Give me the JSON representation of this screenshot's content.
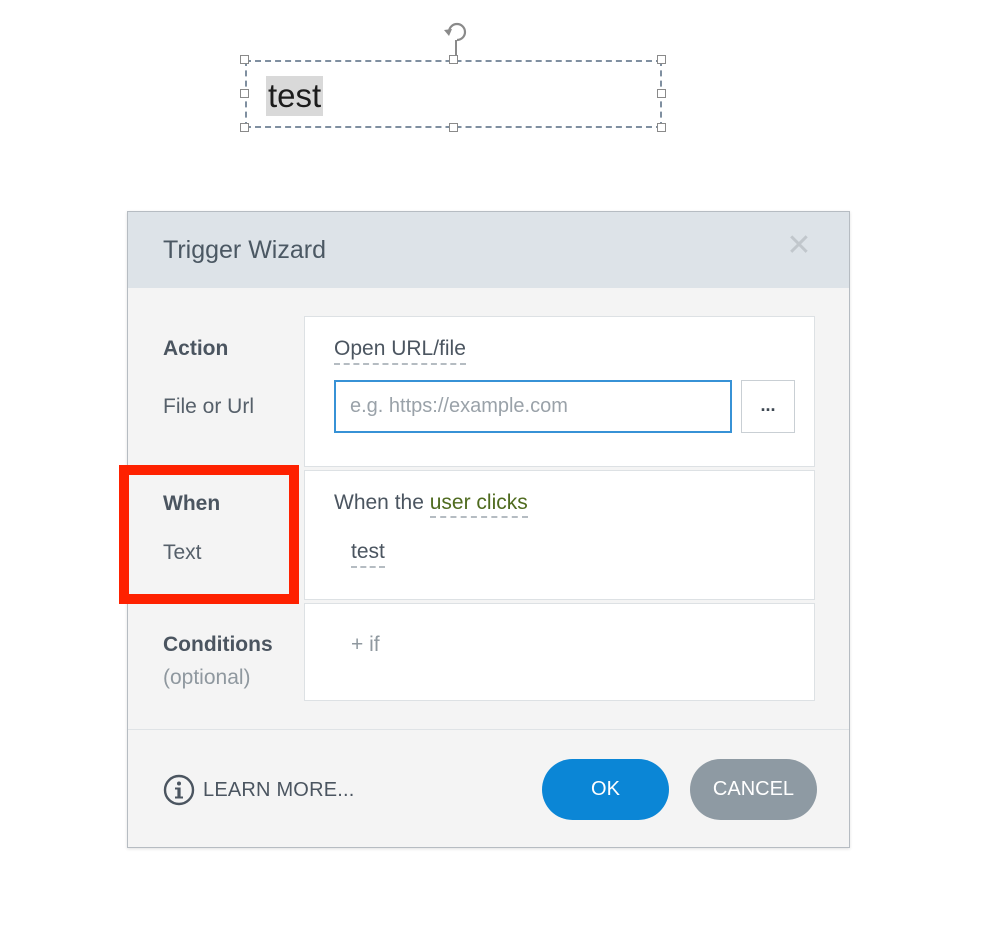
{
  "slide_object": {
    "text": "test"
  },
  "dialog": {
    "title": "Trigger Wizard",
    "close_icon": "close-icon",
    "action_row": {
      "label": "Action",
      "action_value": "Open URL/file",
      "file_label": "File or Url",
      "url_input_value": "",
      "url_input_placeholder": "e.g. https://example.com",
      "browse_label": "..."
    },
    "when_row": {
      "label": "When",
      "target_label": "Text",
      "when_prefix": "When the",
      "when_event": "user clicks",
      "target_value": "test"
    },
    "conditions_row": {
      "label": "Conditions",
      "optional_label": "(optional)",
      "add_condition_label": "+ if"
    },
    "footer": {
      "learn_more_label": "LEARN MORE...",
      "ok_label": "OK",
      "cancel_label": "CANCEL",
      "info_icon": "info-icon"
    }
  },
  "colors": {
    "accent_blue": "#0b86d6",
    "cancel_gray": "#8e9aa3",
    "highlight_red": "#fe2100",
    "event_green": "#4f6b1f",
    "header_bg": "#dde3e8"
  }
}
